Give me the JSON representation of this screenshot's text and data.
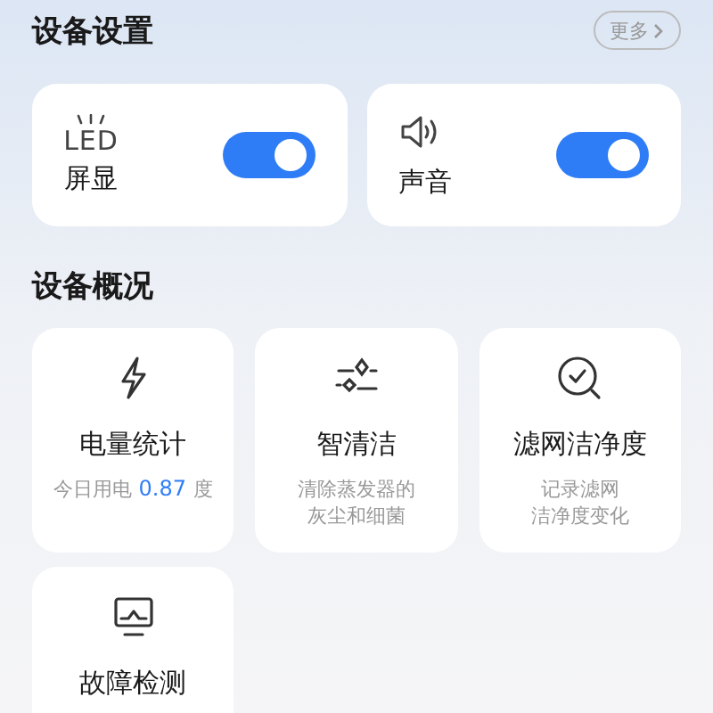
{
  "settings": {
    "title": "设备设置",
    "more": "更多",
    "toggles": [
      {
        "icon_text": "LED",
        "label": "屏显",
        "on": true
      },
      {
        "label": "声音",
        "on": true
      }
    ]
  },
  "overview": {
    "title": "设备概况",
    "cards": [
      {
        "title": "电量统计",
        "kind": "usage",
        "prefix": "今日用电",
        "value": "0.87",
        "unit": "度"
      },
      {
        "title": "智清洁",
        "kind": "desc",
        "desc_lines": [
          "清除蒸发器的",
          "灰尘和细菌"
        ]
      },
      {
        "title": "滤网洁净度",
        "kind": "desc",
        "desc_lines": [
          "记录滤网",
          "洁净度变化"
        ]
      },
      {
        "title": "故障检测",
        "kind": "plain"
      }
    ]
  }
}
